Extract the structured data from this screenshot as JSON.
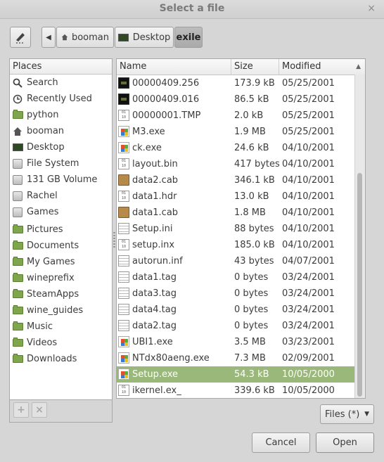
{
  "window": {
    "title": "Select a file",
    "close_glyph": "×"
  },
  "toolbar": {
    "edit_icon": "pencil-icon",
    "back_glyph": "◀",
    "breadcrumbs": [
      {
        "label": "booman",
        "icon": "home-icon"
      },
      {
        "label": "Desktop",
        "icon": "desktop-icon"
      },
      {
        "label": "exile",
        "icon": ""
      }
    ]
  },
  "places": {
    "header": "Places",
    "items": [
      {
        "label": "Search",
        "icon": "search-icon"
      },
      {
        "label": "Recently Used",
        "icon": "recent-icon"
      },
      {
        "label": "python",
        "icon": "folder-icon"
      },
      {
        "label": "booman",
        "icon": "home-icon"
      },
      {
        "label": "Desktop",
        "icon": "desktop-icon"
      },
      {
        "label": "File System",
        "icon": "drive-icon"
      },
      {
        "label": "131 GB Volume",
        "icon": "drive-icon"
      },
      {
        "label": "Rachel",
        "icon": "drive-icon"
      },
      {
        "label": "Games",
        "icon": "drive-icon"
      },
      {
        "label": "Pictures",
        "icon": "folder-icon"
      },
      {
        "label": "Documents",
        "icon": "folder-icon"
      },
      {
        "label": "My Games",
        "icon": "folder-icon"
      },
      {
        "label": "wineprefix",
        "icon": "folder-icon"
      },
      {
        "label": "SteamApps",
        "icon": "folder-icon"
      },
      {
        "label": "wine_guides",
        "icon": "folder-icon"
      },
      {
        "label": "Music",
        "icon": "folder-icon"
      },
      {
        "label": "Videos",
        "icon": "folder-icon"
      },
      {
        "label": "Downloads",
        "icon": "folder-icon"
      }
    ],
    "add_glyph": "+",
    "remove_glyph": "×"
  },
  "file_list": {
    "columns": {
      "name": "Name",
      "size": "Size",
      "modified": "Modified",
      "sort_glyph": "▲"
    },
    "rows": [
      {
        "name": "00000409.256",
        "size": "173.9 kB",
        "modified": "05/25/2001",
        "icon": "film"
      },
      {
        "name": "00000409.016",
        "size": "86.5 kB",
        "modified": "05/25/2001",
        "icon": "film"
      },
      {
        "name": "00000001.TMP",
        "size": "2.0 kB",
        "modified": "05/25/2001",
        "icon": "bin"
      },
      {
        "name": "M3.exe",
        "size": "1.9 MB",
        "modified": "05/25/2001",
        "icon": "win"
      },
      {
        "name": "ck.exe",
        "size": "24.6 kB",
        "modified": "04/10/2001",
        "icon": "win"
      },
      {
        "name": "layout.bin",
        "size": "417 bytes",
        "modified": "04/10/2001",
        "icon": "bin"
      },
      {
        "name": "data2.cab",
        "size": "346.1 kB",
        "modified": "04/10/2001",
        "icon": "cab"
      },
      {
        "name": "data1.hdr",
        "size": "13.0 kB",
        "modified": "04/10/2001",
        "icon": "bin"
      },
      {
        "name": "data1.cab",
        "size": "1.8 MB",
        "modified": "04/10/2001",
        "icon": "cab"
      },
      {
        "name": "Setup.ini",
        "size": "88 bytes",
        "modified": "04/10/2001",
        "icon": "doc"
      },
      {
        "name": "setup.inx",
        "size": "185.0 kB",
        "modified": "04/10/2001",
        "icon": "bin"
      },
      {
        "name": "autorun.inf",
        "size": "43 bytes",
        "modified": "04/07/2001",
        "icon": "doc"
      },
      {
        "name": "data1.tag",
        "size": "0 bytes",
        "modified": "03/24/2001",
        "icon": "doc"
      },
      {
        "name": "data3.tag",
        "size": "0 bytes",
        "modified": "03/24/2001",
        "icon": "doc"
      },
      {
        "name": "data4.tag",
        "size": "0 bytes",
        "modified": "03/24/2001",
        "icon": "doc"
      },
      {
        "name": "data2.tag",
        "size": "0 bytes",
        "modified": "03/24/2001",
        "icon": "doc"
      },
      {
        "name": "UBI1.exe",
        "size": "3.5 MB",
        "modified": "03/23/2001",
        "icon": "win"
      },
      {
        "name": "NTdx80aeng.exe",
        "size": "7.3 MB",
        "modified": "02/09/2001",
        "icon": "win"
      },
      {
        "name": "Setup.exe",
        "size": "54.3 kB",
        "modified": "10/05/2000",
        "icon": "win",
        "selected": true
      },
      {
        "name": "ikernel.ex_",
        "size": "339.6 kB",
        "modified": "10/05/2000",
        "icon": "bin"
      }
    ]
  },
  "filter": {
    "label": "Files (*)",
    "arrow": "▼"
  },
  "buttons": {
    "cancel": "Cancel",
    "open": "Open"
  },
  "bin_icon_text": "01\n10"
}
